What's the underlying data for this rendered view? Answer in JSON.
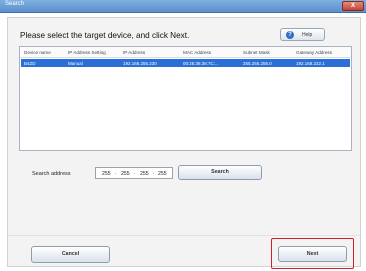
{
  "window": {
    "title": "Search",
    "close_label": "X"
  },
  "prompt": "Please select the target device, and click Next.",
  "help": {
    "label": "Help",
    "icon": "question-icon"
  },
  "device_list": {
    "columns": [
      "Device name",
      "IP Address Setting",
      "IP Address",
      "MAC Address",
      "Subnet Mask",
      "Gateway Address"
    ],
    "rows": [
      [
        "B4ZD",
        "Manual",
        "192.168.255.230",
        "00:25:36:36:7C:...",
        "255.255.255.0",
        "192.168.222.1"
      ]
    ],
    "selected_row": 0
  },
  "search": {
    "label": "Search address",
    "octets": [
      "255",
      "255",
      "255",
      "255"
    ],
    "button_label": "Search"
  },
  "buttons": {
    "cancel": "Cancel",
    "next": "Next"
  },
  "colors": {
    "selection": "#2a6fd8",
    "highlight": "#d41d2b",
    "titlebar": "#5b8fcb"
  }
}
